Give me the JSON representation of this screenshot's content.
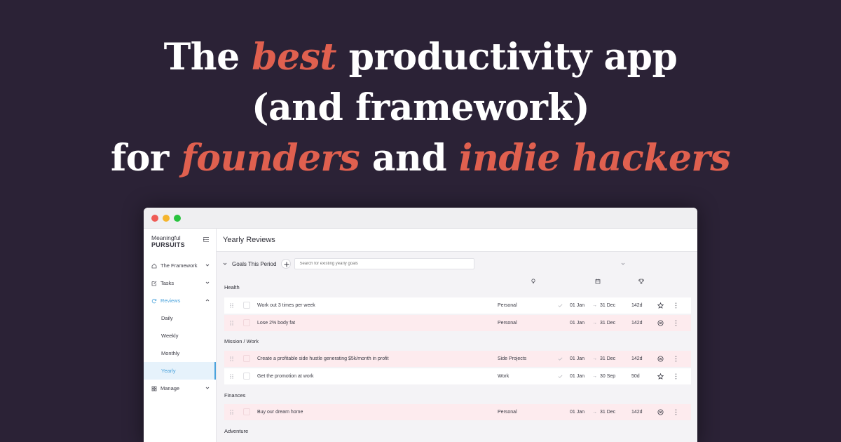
{
  "headline": {
    "l1_a": "The ",
    "l1_b": "best",
    "l1_c": " productivity app",
    "l2": "(and framework)",
    "l3_a": "for ",
    "l3_b": "founders",
    "l3_c": " and ",
    "l3_d": "indie hackers"
  },
  "colors": {
    "background": "#2b2236",
    "accent": "#e0604f",
    "active_nav": "#4ba3dc",
    "pink_row": "#fdebee"
  },
  "sidebar": {
    "brand_line1": "Meaningful",
    "brand_line2": "PURSUITS",
    "items": [
      {
        "label": "The Framework",
        "icon": "home-icon"
      },
      {
        "label": "Tasks",
        "icon": "edit-icon"
      },
      {
        "label": "Reviews",
        "icon": "refresh-icon"
      },
      {
        "label": "Daily"
      },
      {
        "label": "Weekly"
      },
      {
        "label": "Monthly"
      },
      {
        "label": "Yearly"
      },
      {
        "label": "Manage",
        "icon": "grid-icon"
      }
    ]
  },
  "main": {
    "page_title": "Yearly Reviews",
    "goals_title": "Goals This Period",
    "search_placeholder": "Search for existing yearly goals",
    "groups": [
      {
        "label": "Health"
      },
      {
        "label": "Mission / Work"
      },
      {
        "label": "Finances"
      },
      {
        "label": "Adventure"
      }
    ],
    "rows": [
      {
        "title": "Work out 3 times per week",
        "category": "Personal",
        "start": "01 Jan",
        "end": "31 Dec",
        "duration": "142d",
        "status": "star-icon"
      },
      {
        "title": "Lose 2% body fat",
        "category": "Personal",
        "start": "01 Jan",
        "end": "31 Dec",
        "duration": "142d",
        "status": "cancel-circle-icon"
      },
      {
        "title": "Create a profitable side hustle generating $5k/month in profit",
        "category": "Side Projects",
        "start": "01 Jan",
        "end": "31 Dec",
        "duration": "142d",
        "status": "cancel-circle-icon"
      },
      {
        "title": "Get the promotion at work",
        "category": "Work",
        "start": "01 Jan",
        "end": "30 Sep",
        "duration": "50d",
        "status": "star-icon"
      },
      {
        "title": "Buy our dream home",
        "category": "Personal",
        "start": "01 Jan",
        "end": "31 Dec",
        "duration": "142d",
        "status": "cancel-circle-icon"
      }
    ],
    "arrow": "→"
  }
}
